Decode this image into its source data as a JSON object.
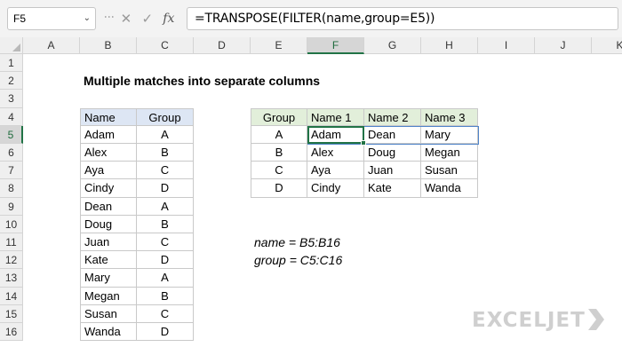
{
  "formula_bar": {
    "name_box": "F5",
    "cancel_icon": "✕",
    "enter_icon": "✓",
    "fx_label": "fx",
    "formula": "=TRANSPOSE(FILTER(name,group=E5))"
  },
  "columns": [
    "A",
    "B",
    "C",
    "D",
    "E",
    "F",
    "G",
    "H",
    "I",
    "J",
    "K"
  ],
  "active_column": "F",
  "rows": [
    "1",
    "2",
    "3",
    "4",
    "5",
    "6",
    "7",
    "8",
    "9",
    "10",
    "11",
    "12",
    "13",
    "14",
    "15",
    "16"
  ],
  "active_row": "5",
  "title": "Multiple matches into separate columns",
  "source_table": {
    "headers": [
      "Name",
      "Group"
    ],
    "rows": [
      [
        "Adam",
        "A"
      ],
      [
        "Alex",
        "B"
      ],
      [
        "Aya",
        "C"
      ],
      [
        "Cindy",
        "D"
      ],
      [
        "Dean",
        "A"
      ],
      [
        "Doug",
        "B"
      ],
      [
        "Juan",
        "C"
      ],
      [
        "Kate",
        "D"
      ],
      [
        "Mary",
        "A"
      ],
      [
        "Megan",
        "B"
      ],
      [
        "Susan",
        "C"
      ],
      [
        "Wanda",
        "D"
      ]
    ]
  },
  "result_table": {
    "headers": [
      "Group",
      "Name 1",
      "Name 2",
      "Name 3"
    ],
    "rows": [
      [
        "A",
        "Adam",
        "Dean",
        "Mary"
      ],
      [
        "B",
        "Alex",
        "Doug",
        "Megan"
      ],
      [
        "C",
        "Aya",
        "Juan",
        "Susan"
      ],
      [
        "D",
        "Cindy",
        "Kate",
        "Wanda"
      ]
    ]
  },
  "notes": [
    "name = B5:B16",
    "group = C5:C16"
  ],
  "logo": "EXCELJET",
  "colors": {
    "selection": "#217346",
    "header_blue": "#dde6f4",
    "header_green": "#e2efda",
    "spill_border": "#4f84c9"
  }
}
